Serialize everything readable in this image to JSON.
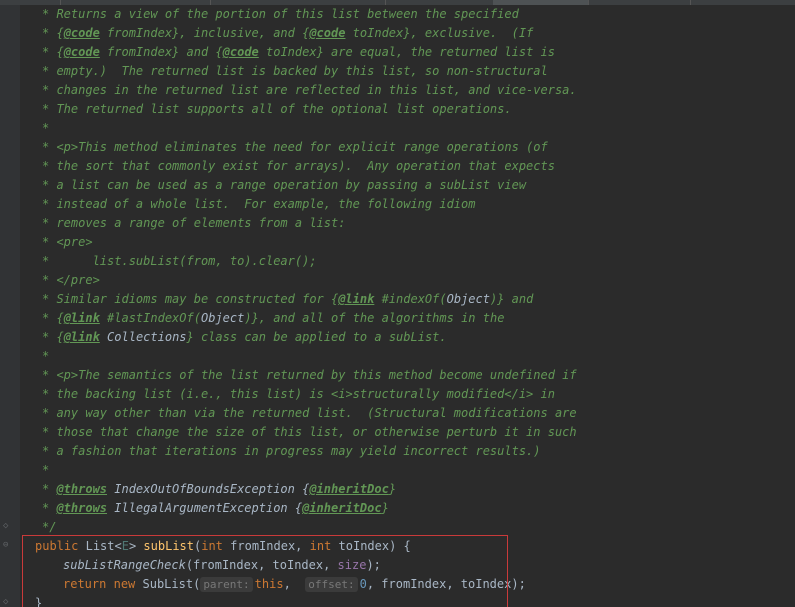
{
  "editor": {
    "language": "java",
    "highlight_color": "#c93a3a",
    "comment_color": "#629755",
    "keyword_color": "#cc7832"
  },
  "comment": {
    "l1": "Returns a view of the portion of this list between the specified",
    "l2a": "{",
    "l2tag": "@code",
    "l2b": " fromIndex}, inclusive, and {",
    "l2tag2": "@code",
    "l2c": " toIndex}, exclusive.  (If",
    "l3a": "{",
    "l3tag": "@code",
    "l3b": " fromIndex} and {",
    "l3tag2": "@code",
    "l3c": " toIndex} are equal, the returned list is",
    "l4": "empty.)  The returned list is backed by this list, so non-structural",
    "l5": "changes in the returned list are reflected in this list, and vice-versa.",
    "l6": "The returned list supports all of the optional list operations.",
    "l8": "<p>This method eliminates the need for explicit range operations (of",
    "l9": "the sort that commonly exist for arrays).  Any operation that expects",
    "l10": "a list can be used as a range operation by passing a subList view",
    "l11": "instead of a whole list.  For example, the following idiom",
    "l12": "removes a range of elements from a list:",
    "l13": "<pre>",
    "l14": "     list.subList(from, to).clear();",
    "l15": "</pre>",
    "l16a": "Similar idioms may be constructed for {",
    "l16tag": "@link",
    "l16b": " #indexOf(",
    "l16ref": "Object",
    "l16c": ")} and",
    "l17a": "{",
    "l17tag": "@link",
    "l17b": " #lastIndexOf(",
    "l17ref": "Object",
    "l17c": ")}, and all of the algorithms in the",
    "l18a": "{",
    "l18tag": "@link",
    "l18b": " ",
    "l18ref": "Collections",
    "l18c": "} class can be applied to a subList.",
    "l20": "<p>The semantics of the list returned by this method become undefined if",
    "l21": "the backing list (i.e., this list) is <i>structurally modified</i> in",
    "l22": "any way other than via the returned list.  (Structural modifications are",
    "l23": "those that change the size of this list, or otherwise perturb it in such",
    "l24": "a fashion that iterations in progress may yield incorrect results.)",
    "l26tag": "@throws",
    "l26a": " IndexOutOfBoundsException {",
    "l26tag2": "@inheritDoc",
    "l26b": "}",
    "l27tag": "@throws",
    "l27a": " IllegalArgumentException {",
    "l27tag2": "@inheritDoc",
    "l27b": "}",
    "end": "*/"
  },
  "code": {
    "sig_public": "public",
    "sig_type": "List<",
    "sig_gen": "E",
    "sig_type2": ">",
    "sig_name": "subList",
    "sig_p1kw": "int",
    "sig_p1": " fromIndex, ",
    "sig_p2kw": "int",
    "sig_p2": " toIndex) {",
    "call_name": "subListRangeCheck",
    "call_args_a": "(fromIndex, toIndex, ",
    "call_field": "size",
    "call_args_b": ");",
    "ret_kw": "return",
    "ret_new": "new",
    "ret_cls": " SubList(",
    "hint_parent": "parent:",
    "ret_this": "this",
    "ret_sep": ", ",
    "hint_offset": "offset:",
    "ret_num": "0",
    "ret_rest": ", fromIndex, toIndex);",
    "close": "}"
  }
}
